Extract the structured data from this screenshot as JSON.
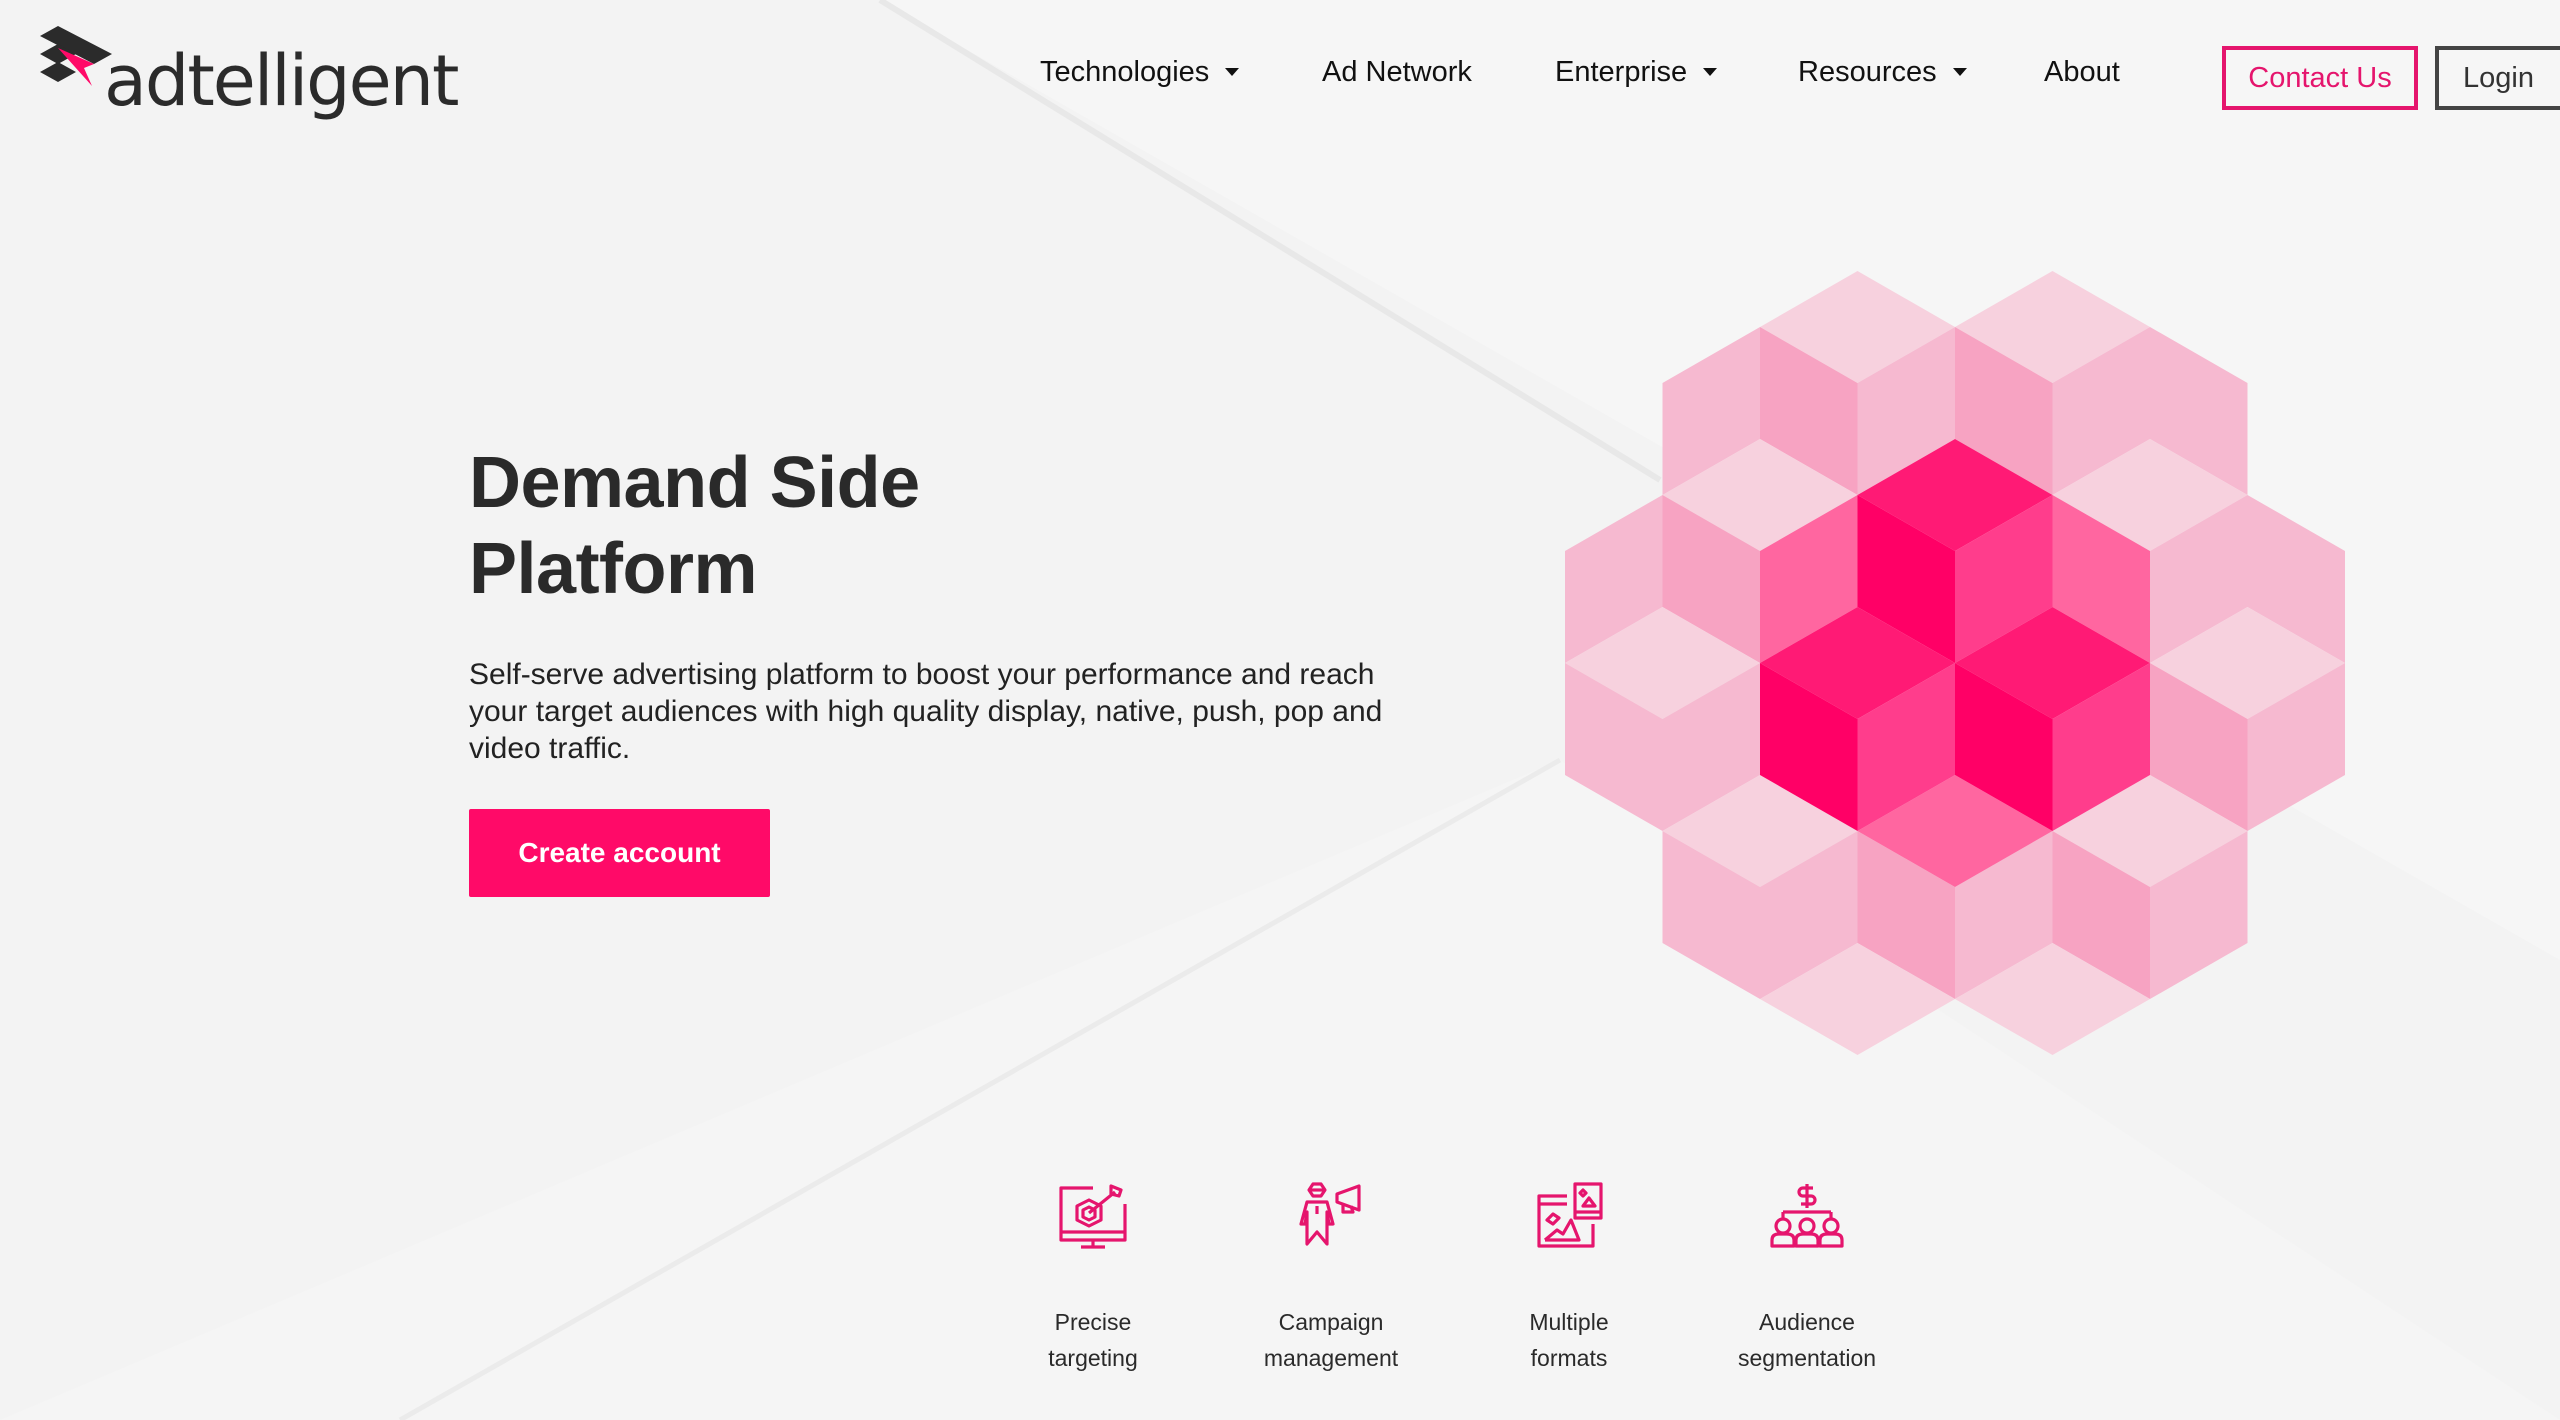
{
  "brand": {
    "logo_text": "adtelligent",
    "accent_color": "#ff0a68",
    "dark_color": "#2b2b2b"
  },
  "nav": {
    "items": [
      {
        "label": "Technologies",
        "has_dropdown": true
      },
      {
        "label": "Ad Network",
        "has_dropdown": false
      },
      {
        "label": "Enterprise",
        "has_dropdown": true
      },
      {
        "label": "Resources",
        "has_dropdown": true
      },
      {
        "label": "About",
        "has_dropdown": false
      }
    ],
    "contact_label": "Contact Us",
    "login_label": "Login"
  },
  "hero": {
    "title_line1": "Demand Side",
    "title_line2": "Platform",
    "description": "Self-serve advertising platform to boost your performance and reach your target audiences with high quality display, native, push, pop and video traffic.",
    "cta_label": "Create account"
  },
  "graphic": {
    "description": "isometric-cube-hexagon",
    "colors": {
      "top": "#ff1a75",
      "left": "#ff0066",
      "right": "#ff3d8c",
      "mid": "#ff66a0",
      "light1": "#f7d1de",
      "light2": "#f6b9d0",
      "light3": "#f7a3c2"
    }
  },
  "features": [
    {
      "icon": "monitor-target-icon",
      "line1": "Precise",
      "line2": "targeting"
    },
    {
      "icon": "megaphone-person-icon",
      "line1": "Campaign",
      "line2": "management"
    },
    {
      "icon": "multiple-formats-icon",
      "line1": "Multiple",
      "line2": "formats"
    },
    {
      "icon": "audience-segmentation-icon",
      "line1": "Audience",
      "line2": "segmentation"
    }
  ]
}
